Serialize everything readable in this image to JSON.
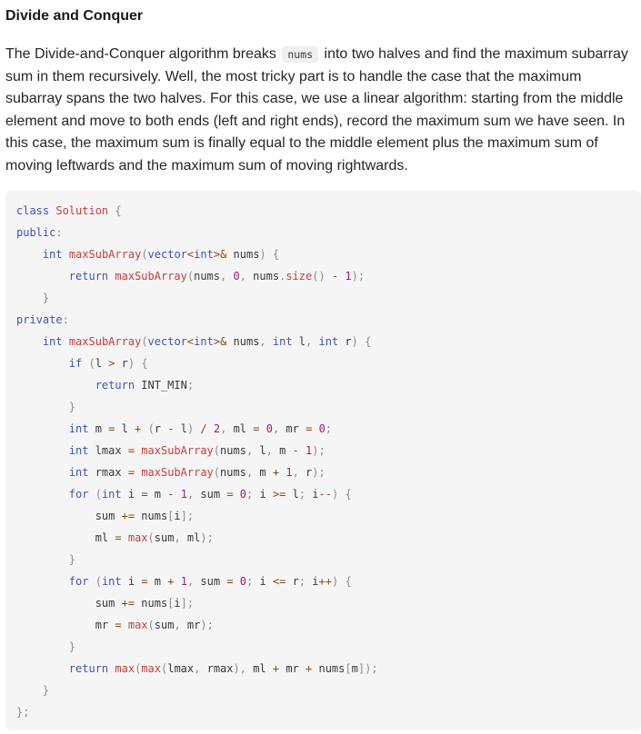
{
  "heading": "Divide and Conquer",
  "paragraph": {
    "before": "The Divide-and-Conquer algorithm breaks",
    "code": "nums",
    "after": "into two halves and find the maximum subarray sum in them recursively. Well, the most tricky part is to handle the case that the maximum subarray spans the two halves. For this case, we use a linear algorithm: starting from the middle element and move to both ends (left and right ends), record the maximum sum we have seen. In this case, the maximum sum is finally equal to the middle element plus the maximum sum of moving leftwards and the maximum sum of moving rightwards."
  },
  "code_lines": [
    "class Solution {",
    "public:",
    "    int maxSubArray(vector<int>& nums) {",
    "        return maxSubArray(nums, 0, nums.size() - 1);",
    "    }",
    "private:",
    "    int maxSubArray(vector<int>& nums, int l, int r) {",
    "        if (l > r) {",
    "            return INT_MIN;",
    "        }",
    "        int m = l + (r - l) / 2, ml = 0, mr = 0;",
    "        int lmax = maxSubArray(nums, l, m - 1);",
    "        int rmax = maxSubArray(nums, m + 1, r);",
    "        for (int i = m - 1, sum = 0; i >= l; i--) {",
    "            sum += nums[i];",
    "            ml = max(sum, ml);",
    "        }",
    "        for (int i = m + 1, sum = 0; i <= r; i++) {",
    "            sum += nums[i];",
    "            mr = max(sum, mr);",
    "        }",
    "        return max(max(lmax, rmax), ml + mr + nums[m]);",
    "    }",
    "};"
  ]
}
